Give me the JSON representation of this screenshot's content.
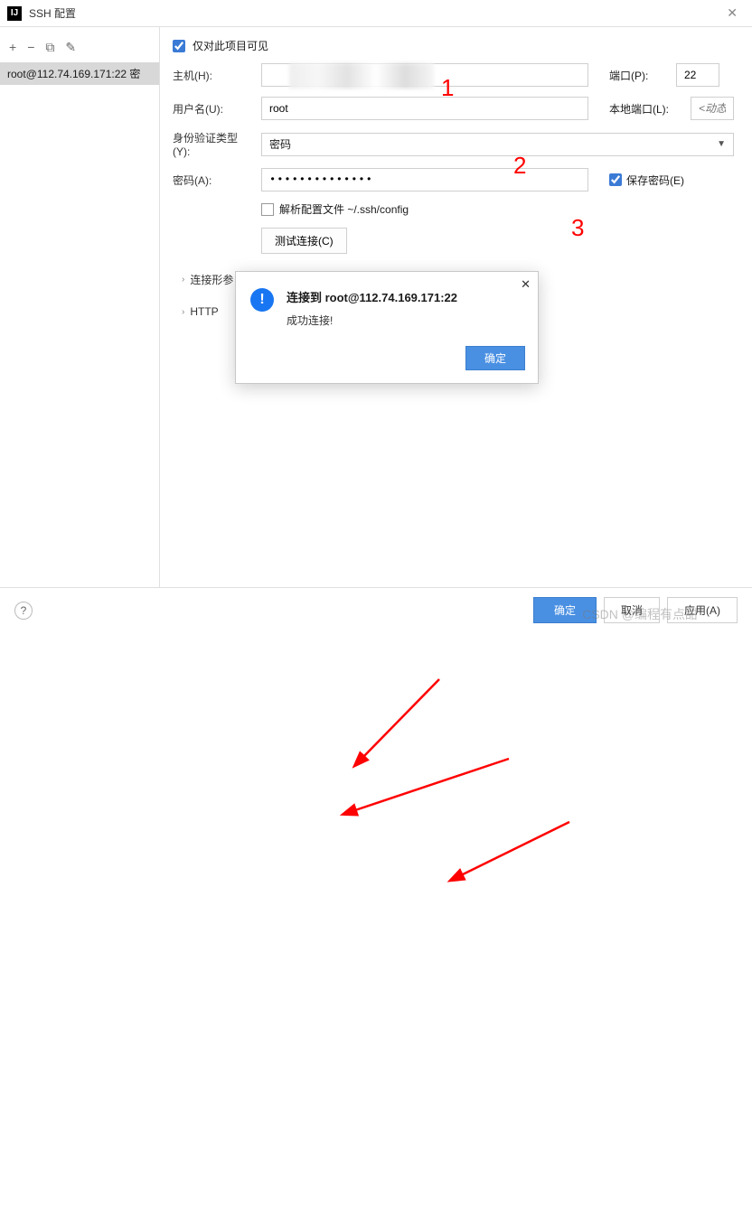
{
  "titlebar": {
    "title": "SSH 配置"
  },
  "sidebar": {
    "items": [
      "root@112.74.169.171:22 密"
    ]
  },
  "form": {
    "visible_only_label": "仅对此项目可见",
    "visible_only_checked": true,
    "host_label": "主机(H):",
    "host_value": "",
    "port_label": "端口(P):",
    "port_value": "22",
    "user_label": "用户名(U):",
    "user_value": "root",
    "local_port_label": "本地端口(L):",
    "local_port_placeholder": "<动态>",
    "authtype_label": "身份验证类型(Y):",
    "authtype_value": "密码",
    "password_label": "密码(A):",
    "password_value": "••••••••••••••",
    "save_pwd_label": "保存密码(E)",
    "save_pwd_checked": true,
    "parse_cfg_label": "解析配置文件 ~/.ssh/config",
    "test_conn_label": "测试连接(C)",
    "section_conn_args": "连接形参",
    "section_http": "HTTP"
  },
  "dialog": {
    "title": "连接到 root@112.74.169.171:22",
    "message": "成功连接!",
    "ok": "确定"
  },
  "bottom": {
    "ok": "确定",
    "cancel": "取消",
    "apply": "应用(A)"
  },
  "annotations": {
    "n1": "1",
    "n2": "2",
    "n3": "3"
  },
  "watermark": "CSDN @编程有点甜"
}
